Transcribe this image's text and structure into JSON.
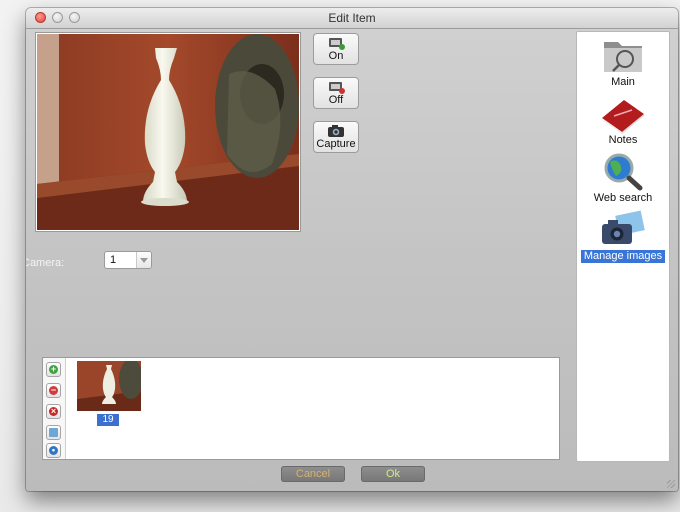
{
  "window": {
    "title": "Edit Item"
  },
  "camera_buttons": [
    {
      "label": "On",
      "icon": "webcam-on-icon"
    },
    {
      "label": "Off",
      "icon": "webcam-off-icon"
    },
    {
      "label": "Capture",
      "icon": "camera-icon"
    }
  ],
  "camera": {
    "label": "Camera:",
    "selected": "1"
  },
  "gallery": {
    "tools": [
      "add-icon",
      "remove-icon",
      "delete-icon",
      "edit-icon",
      "export-icon"
    ],
    "thumbnails": [
      {
        "caption": "19"
      }
    ]
  },
  "dialog_buttons": {
    "cancel": "Cancel",
    "ok": "Ok"
  },
  "sidebar": {
    "items": [
      {
        "label": "Main",
        "icon": "folder-icon",
        "selected": false
      },
      {
        "label": "Notes",
        "icon": "notebook-icon",
        "selected": false
      },
      {
        "label": "Web search",
        "icon": "magnifier-globe-icon",
        "selected": false
      },
      {
        "label": "Manage images",
        "icon": "photo-camera-icon",
        "selected": true
      }
    ]
  },
  "colors": {
    "selection": "#3875d7",
    "caption_bg": "#3b6fd0"
  }
}
